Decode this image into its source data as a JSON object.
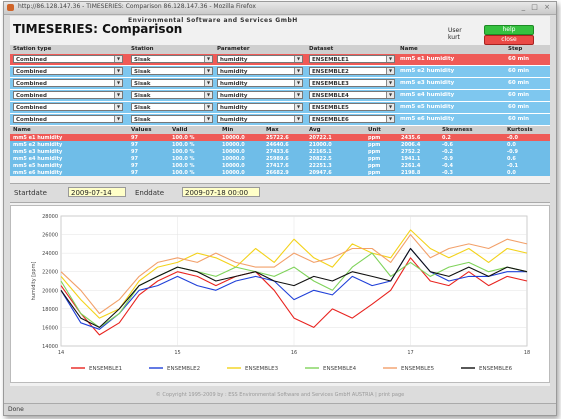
{
  "window": {
    "title": "http://86.128.147.36 - TIMESERIES: Comparison 86.128.147.36 - Mozilla Firefox",
    "controls": "_ □ ×"
  },
  "header": {
    "company": "Environmental Software and Services GmbH",
    "title": "TIMESERIES: Comparison",
    "user_label": "User",
    "user_name": "kurt",
    "help_label": "help",
    "close_label": "close"
  },
  "selection": {
    "columns": [
      "Station type",
      "Station",
      "Parameter",
      "Dataset",
      "Name",
      "Step"
    ],
    "rows": [
      {
        "station_type": "Combined",
        "station": "Sisak",
        "parameter": "humidity",
        "dataset": "ENSEMBLE1",
        "name": "mm5 e1 humidity",
        "step": "60 min",
        "color": "red"
      },
      {
        "station_type": "Combined",
        "station": "Sisak",
        "parameter": "humidity",
        "dataset": "ENSEMBLE2",
        "name": "mm5 e2 humidity",
        "step": "60 min",
        "color": "blue"
      },
      {
        "station_type": "Combined",
        "station": "Sisak",
        "parameter": "humidity",
        "dataset": "ENSEMBLE3",
        "name": "mm5 e3 humidity",
        "step": "60 min",
        "color": "blue"
      },
      {
        "station_type": "Combined",
        "station": "Sisak",
        "parameter": "humidity",
        "dataset": "ENSEMBLE4",
        "name": "mm5 e4 humidity",
        "step": "60 min",
        "color": "blue"
      },
      {
        "station_type": "Combined",
        "station": "Sisak",
        "parameter": "humidity",
        "dataset": "ENSEMBLE5",
        "name": "mm5 e5 humidity",
        "step": "60 min",
        "color": "blue"
      },
      {
        "station_type": "Combined",
        "station": "Sisak",
        "parameter": "humidity",
        "dataset": "ENSEMBLE6",
        "name": "mm5 e6 humidity",
        "step": "60 min",
        "color": "blue"
      }
    ]
  },
  "stats": {
    "columns": [
      "Name",
      "Values",
      "Valid",
      "Min",
      "Max",
      "Avg",
      "Unit",
      "σ",
      "Skewness",
      "Kurtosis"
    ],
    "rows": [
      [
        "mm5 e1 humidity",
        "97",
        "100.0 %",
        "10000.0",
        "25722.6",
        "20722.1",
        "ppm",
        "2435.6",
        "0.2",
        "-0.0"
      ],
      [
        "mm5 e2 humidity",
        "97",
        "100.0 %",
        "10000.0",
        "24640.6",
        "21000.0",
        "ppm",
        "2006.4",
        "-0.6",
        "0.0"
      ],
      [
        "mm5 e3 humidity",
        "97",
        "100.0 %",
        "10000.0",
        "27433.6",
        "22165.1",
        "ppm",
        "2752.2",
        "-0.2",
        "-0.9"
      ],
      [
        "mm5 e4 humidity",
        "97",
        "100.0 %",
        "10000.0",
        "25989.6",
        "20822.5",
        "ppm",
        "1941.1",
        "-0.9",
        "0.6"
      ],
      [
        "mm5 e5 humidity",
        "97",
        "100.0 %",
        "10000.0",
        "27417.6",
        "22251.3",
        "ppm",
        "2261.4",
        "-0.4",
        "-0.1"
      ],
      [
        "mm5 e6 humidity",
        "97",
        "100.0 %",
        "10000.0",
        "26682.9",
        "20947.6",
        "ppm",
        "2198.8",
        "-0.3",
        "0.0"
      ]
    ]
  },
  "dates": {
    "start_label": "Startdate",
    "start_value": "2009-07-14",
    "end_label": "Enddate",
    "end_value": "2009-07-18 00:00"
  },
  "chart_data": {
    "type": "line",
    "ylabel": "humidity [ppm]",
    "ylim": [
      14000,
      28000
    ],
    "yticks": [
      "28000",
      "26000",
      "24000",
      "22000",
      "20000",
      "18000",
      "16000",
      "14000"
    ],
    "xlim": [
      14,
      18
    ],
    "xticks": [
      "14",
      "15",
      "16",
      "17",
      "18"
    ],
    "grid": true,
    "legend_position": "bottom",
    "x": [
      14,
      14.17,
      14.33,
      14.5,
      14.67,
      14.83,
      15,
      15.17,
      15.33,
      15.5,
      15.67,
      15.83,
      16,
      16.17,
      16.33,
      16.5,
      16.67,
      16.83,
      17,
      17.17,
      17.33,
      17.5,
      17.67,
      17.83,
      18
    ],
    "series": [
      {
        "name": "ENSEMBLE1",
        "color": "#e8231f",
        "values": [
          20500,
          17500,
          15200,
          16500,
          19500,
          21000,
          22000,
          21500,
          20500,
          21500,
          22000,
          20000,
          17000,
          16000,
          18000,
          17000,
          18500,
          20000,
          23500,
          21000,
          20500,
          22000,
          20500,
          21500,
          21000
        ]
      },
      {
        "name": "ENSEMBLE2",
        "color": "#2040d8",
        "values": [
          20000,
          16500,
          15800,
          17500,
          20000,
          20500,
          21500,
          20500,
          20000,
          21000,
          21500,
          21000,
          19000,
          20000,
          19500,
          21500,
          20500,
          21000,
          24500,
          22000,
          21000,
          21500,
          21500,
          22000,
          22000
        ]
      },
      {
        "name": "ENSEMBLE3",
        "color": "#f3d21a",
        "values": [
          21500,
          19000,
          17000,
          18000,
          21000,
          22500,
          23000,
          24000,
          23500,
          22500,
          24500,
          23000,
          25500,
          23500,
          22500,
          25000,
          24000,
          23500,
          26500,
          24500,
          23500,
          24500,
          23000,
          24500,
          24000
        ]
      },
      {
        "name": "ENSEMBLE4",
        "color": "#7fd35a",
        "values": [
          21000,
          17500,
          16000,
          17500,
          20500,
          21500,
          22500,
          22000,
          21500,
          22500,
          22000,
          21500,
          22500,
          21000,
          20000,
          22500,
          24000,
          21500,
          23000,
          21500,
          22500,
          23000,
          22000,
          22500,
          22000
        ]
      },
      {
        "name": "ENSEMBLE5",
        "color": "#f2a06a",
        "values": [
          22000,
          20000,
          17500,
          19000,
          21500,
          23000,
          23500,
          23000,
          24000,
          23000,
          22500,
          22500,
          24000,
          23000,
          23500,
          24500,
          24500,
          23000,
          26000,
          23500,
          24500,
          25000,
          24500,
          25500,
          25000
        ]
      },
      {
        "name": "ENSEMBLE6",
        "color": "#111111",
        "values": [
          20000,
          17000,
          16000,
          18000,
          20500,
          21500,
          22500,
          22000,
          21000,
          21500,
          22000,
          21000,
          20500,
          21500,
          21000,
          22000,
          21500,
          21000,
          24500,
          22000,
          21500,
          22500,
          21500,
          22500,
          22000
        ]
      }
    ]
  },
  "footer": {
    "text": "© Copyright 1995-2009 by : ESS  Environmental Software and Services GmbH AUSTRIA | print page"
  },
  "statusbar": {
    "text": "Done"
  }
}
